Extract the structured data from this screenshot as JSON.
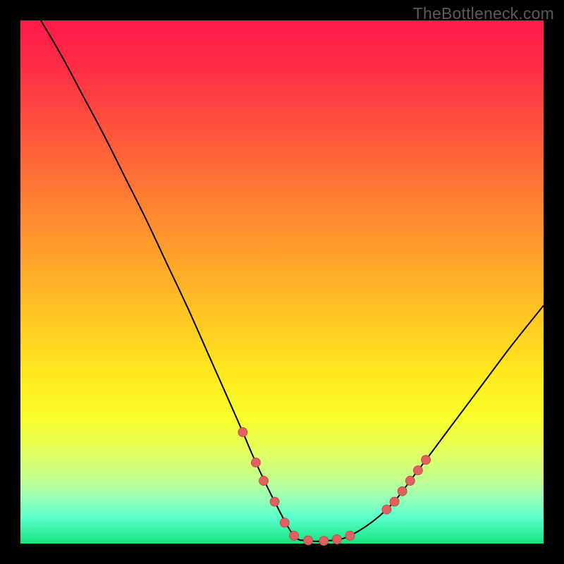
{
  "watermark": "TheBottleneck.com",
  "colors": {
    "background": "#000000",
    "curve": "#000000",
    "marker_fill": "#e16060",
    "marker_stroke": "#bb4343",
    "gradient_top": "#ff1a49",
    "gradient_bottom": "#14e47e"
  },
  "chart_data": {
    "type": "line",
    "title": "",
    "xlabel": "",
    "ylabel": "",
    "xlim": [
      0,
      100
    ],
    "ylim": [
      0,
      100
    ],
    "grid": false,
    "legend": false,
    "series": [
      {
        "name": "bottleneck-curve",
        "x": [
          3.9,
          8,
          12,
          16,
          20,
          24,
          28,
          32,
          36,
          40,
          42.5,
          45,
          48.6,
          52.3,
          55,
          58,
          63,
          70,
          76,
          82,
          88,
          94,
          100
        ],
        "y": [
          100,
          93,
          85.5,
          78,
          70,
          62,
          53.5,
          45,
          36,
          27,
          21.3,
          15.5,
          8,
          1.5,
          0.6,
          0.5,
          1.5,
          6.5,
          14,
          22,
          30,
          38,
          45.5
        ]
      }
    ],
    "markers": {
      "name": "highlight-points",
      "x": [
        42.5,
        45,
        46.5,
        48.6,
        50.5,
        52.3,
        55,
        58,
        60.5,
        63,
        70,
        71.5,
        73,
        74.5,
        76,
        77.5
      ],
      "y": [
        21.3,
        15.5,
        12,
        8,
        4,
        1.5,
        0.6,
        0.5,
        0.8,
        1.5,
        6.5,
        8,
        10,
        12,
        14,
        16
      ]
    }
  }
}
